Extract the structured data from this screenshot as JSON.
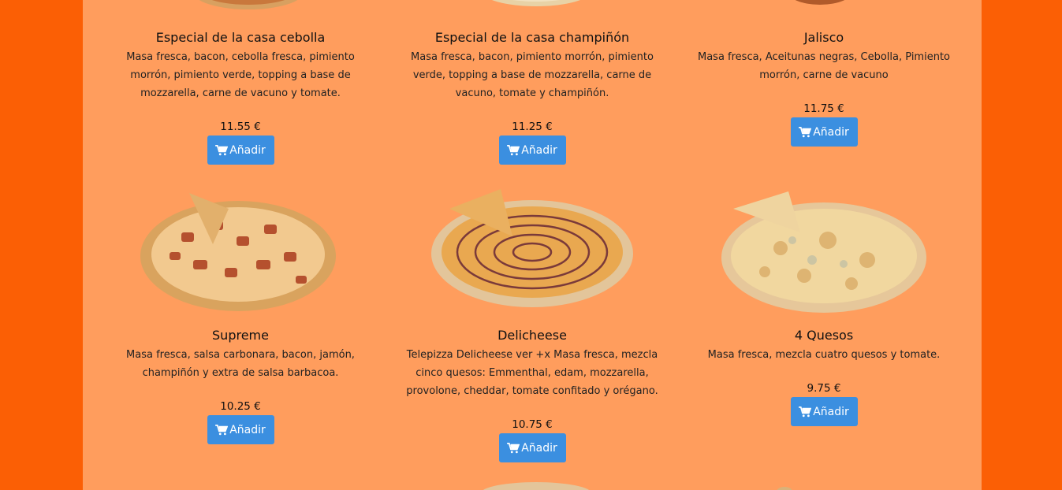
{
  "colors": {
    "outer_bg": "#fb5f05",
    "panel_bg": "#ff9d5d",
    "button_bg": "#3b8fe0",
    "button_text": "#ffffff"
  },
  "cart_icon": "shopping-cart-icon",
  "row1": [
    {
      "name": "Especial de la casa cebolla",
      "description": "Masa fresca, bacon, cebolla fresca, pimiento morrón, pimiento verde, topping a base de mozzarella, carne de vacuno y tomate.",
      "price": "11.55 €",
      "button": "Añadir"
    },
    {
      "name": "Especial de la casa champiñón",
      "description": "Masa fresca, bacon, pimiento morrón, pimiento verde, topping a base de mozzarella, carne de vacuno, tomate y champiñón.",
      "price": "11.25 €",
      "button": "Añadir"
    },
    {
      "name": "Jalisco",
      "description": "Masa fresca, Aceitunas negras, Cebolla, Pimiento morrón, carne de vacuno",
      "price": "11.75 €",
      "button": "Añadir"
    }
  ],
  "row2": [
    {
      "name": "Supreme",
      "description": "Masa fresca, salsa carbonara, bacon, jamón, champiñón y extra de salsa barbacoa.",
      "price": "10.25 €",
      "button": "Añadir"
    },
    {
      "name": "Delicheese",
      "description": "Telepizza Delicheese ver +x Masa fresca, mezcla cinco quesos: Emmenthal, edam, mozzarella, provolone, cheddar, tomate confitado y orégano.",
      "price": "10.75 €",
      "button": "Añadir"
    },
    {
      "name": "4 Quesos",
      "description": "Masa fresca, mezcla cuatro quesos y tomate.",
      "price": "9.75 €",
      "button": "Añadir"
    }
  ]
}
